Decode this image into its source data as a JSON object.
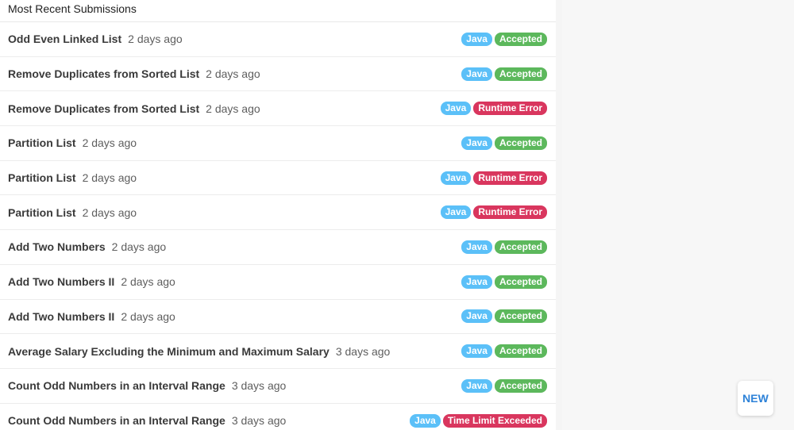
{
  "header": {
    "title": "Most Recent Submissions"
  },
  "colors": {
    "java": "#5bc0f8",
    "accepted": "#5cb85c",
    "runtime_error": "#d9365e",
    "time_limit_exceeded": "#d9365e"
  },
  "submissions": [
    {
      "title": "Odd Even Linked List",
      "time": "2 days ago",
      "lang": "Java",
      "status": "Accepted",
      "status_color": "#5cb85c"
    },
    {
      "title": "Remove Duplicates from Sorted List",
      "time": "2 days ago",
      "lang": "Java",
      "status": "Accepted",
      "status_color": "#5cb85c"
    },
    {
      "title": "Remove Duplicates from Sorted List",
      "time": "2 days ago",
      "lang": "Java",
      "status": "Runtime Error",
      "status_color": "#d9365e"
    },
    {
      "title": "Partition List",
      "time": "2 days ago",
      "lang": "Java",
      "status": "Accepted",
      "status_color": "#5cb85c"
    },
    {
      "title": "Partition List",
      "time": "2 days ago",
      "lang": "Java",
      "status": "Runtime Error",
      "status_color": "#d9365e"
    },
    {
      "title": "Partition List",
      "time": "2 days ago",
      "lang": "Java",
      "status": "Runtime Error",
      "status_color": "#d9365e"
    },
    {
      "title": "Add Two Numbers",
      "time": "2 days ago",
      "lang": "Java",
      "status": "Accepted",
      "status_color": "#5cb85c"
    },
    {
      "title": "Add Two Numbers II",
      "time": "2 days ago",
      "lang": "Java",
      "status": "Accepted",
      "status_color": "#5cb85c"
    },
    {
      "title": "Add Two Numbers II",
      "time": "2 days ago",
      "lang": "Java",
      "status": "Accepted",
      "status_color": "#5cb85c"
    },
    {
      "title": "Average Salary Excluding the Minimum and Maximum Salary",
      "time": "3 days ago",
      "lang": "Java",
      "status": "Accepted",
      "status_color": "#5cb85c"
    },
    {
      "title": "Count Odd Numbers in an Interval Range",
      "time": "3 days ago",
      "lang": "Java",
      "status": "Accepted",
      "status_color": "#5cb85c"
    },
    {
      "title": "Count Odd Numbers in an Interval Range",
      "time": "3 days ago",
      "lang": "Java",
      "status": "Time Limit Exceeded",
      "status_color": "#d9365e"
    }
  ],
  "new_button": {
    "label": "NEW"
  }
}
